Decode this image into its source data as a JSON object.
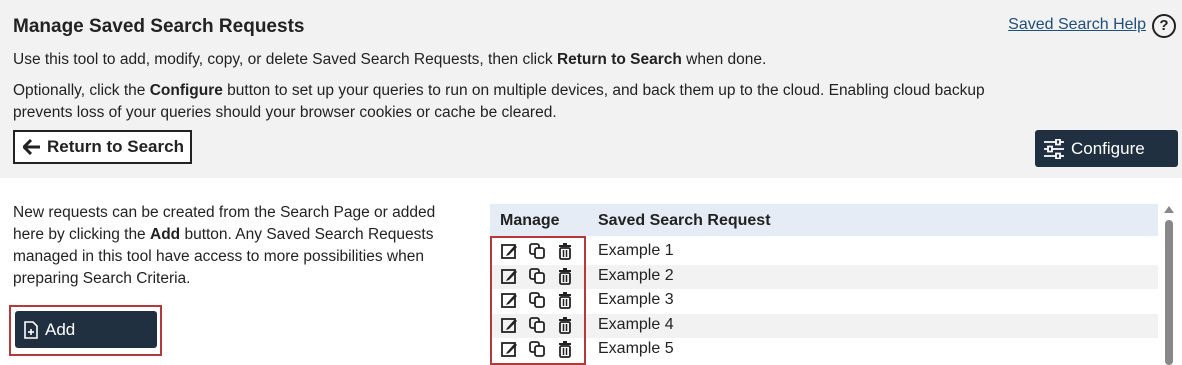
{
  "header": {
    "title": "Manage Saved Search Requests",
    "help_link": "Saved Search Help",
    "help_icon": "?",
    "intro_pre": "Use this tool to add, modify, copy, or delete Saved Search Requests, then click ",
    "intro_bold": "Return to Search",
    "intro_post": " when done.",
    "opt_pre": "Optionally, click the ",
    "opt_bold": "Configure",
    "opt_post": " button to set up your queries to run on multiple devices, and back them up to the cloud. Enabling cloud backup",
    "opt_line2": "prevents loss of your queries should your browser cookies or cache be cleared.",
    "return_label": "Return to Search",
    "configure_label": "Configure"
  },
  "left": {
    "text_pre": "New requests can be created from the Search Page or added here by clicking the ",
    "text_bold": "Add",
    "text_post": " button. Any Saved Search Requests managed in this tool have access to more possibilities when preparing Search Criteria.",
    "add_label": "Add"
  },
  "table": {
    "col_manage": "Manage",
    "col_name": "Saved Search Request",
    "rows": [
      {
        "name": "Example 1"
      },
      {
        "name": "Example 2"
      },
      {
        "name": "Example 3"
      },
      {
        "name": "Example 4"
      },
      {
        "name": "Example 5"
      }
    ]
  },
  "icons": {
    "return": "arrow-left-icon",
    "configure": "sliders-icon",
    "add": "add-file-icon",
    "edit": "edit-icon",
    "copy": "copy-icon",
    "delete": "trash-icon"
  },
  "colors": {
    "primary_button": "#203040",
    "highlight_border": "#b33a3a",
    "header_bg": "#f2f2f2",
    "table_header_bg": "#e6ecf5",
    "link": "#1f4e79"
  }
}
